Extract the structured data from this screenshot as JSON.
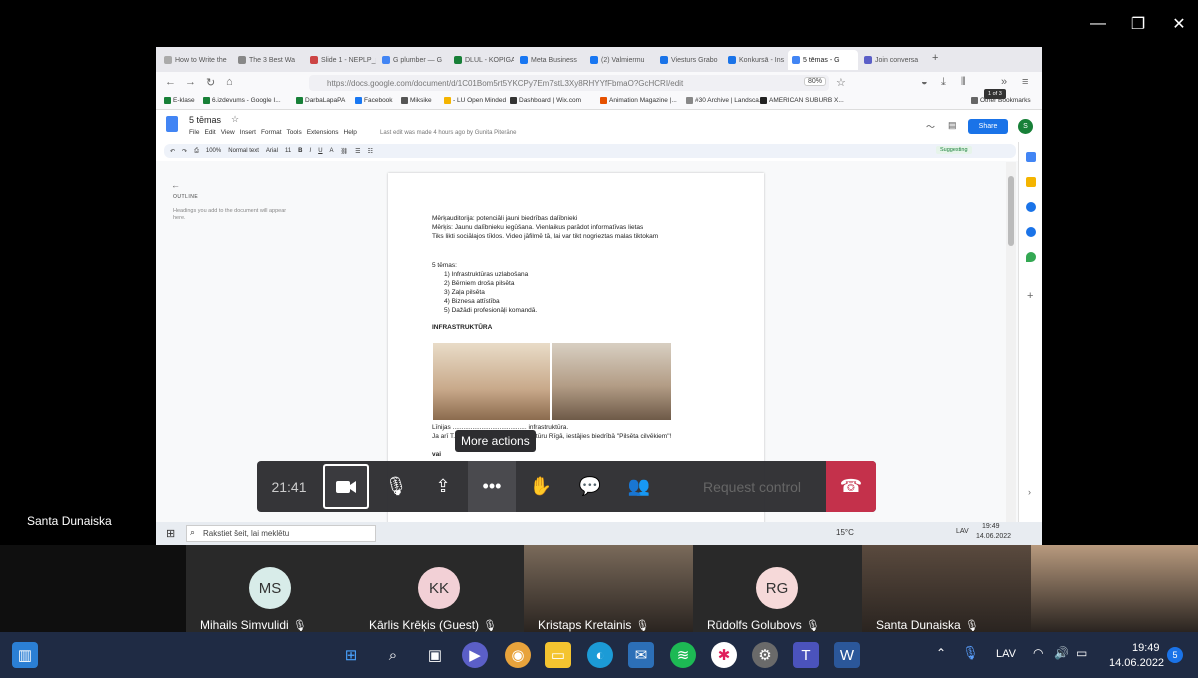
{
  "window": {
    "minimize_icon": "—",
    "maximize_icon": "❐",
    "close_icon": "✕"
  },
  "browser": {
    "tabs": [
      {
        "label": "How to Write the",
        "color": "#aaa"
      },
      {
        "label": "The 3 Best Wa",
        "color": "#888"
      },
      {
        "label": "Slide 1 - NEPLP_p",
        "color": "#c44"
      },
      {
        "label": "G plumber — G",
        "color": "#4285f4"
      },
      {
        "label": "DLUL - KOPIGA",
        "color": "#188038"
      },
      {
        "label": "Meta Business",
        "color": "#1877f2"
      },
      {
        "label": "(2) Valmiermu",
        "color": "#1877f2"
      },
      {
        "label": "Viesturs Grabo",
        "color": "#1a73e8"
      },
      {
        "label": "Konkursā - Ins",
        "color": "#1a73e8"
      },
      {
        "label": "5 tēmas - G",
        "color": "#4285f4"
      },
      {
        "label": "Join conversa",
        "color": "#5b5fc7"
      }
    ],
    "new_tab": "+",
    "url": "https://docs.google.com/document/d/1C01Bom5rt5YKCPy7Em7stL3Xy8RHYYfFbmaO?GcHCRI/edit",
    "zoom": "80%",
    "bookmarks": [
      "E-klase",
      "6.izdevums - Google I...",
      "DarbaLapaPA",
      "Facebook",
      "Miksike",
      "- LU Open Minded",
      "Dashboard | Wix.com",
      "Animation Magazine |...",
      "#30 Archive | Landsca...",
      "AMERICAN SUBURB X...",
      "Other Bookmarks"
    ],
    "bookmark_colors": [
      "#188038",
      "#188038",
      "#188038",
      "#1877f2",
      "#555",
      "#f4b400",
      "#333",
      "#e65100",
      "#888",
      "#222",
      "#666"
    ]
  },
  "docs": {
    "title": "5 tēmas",
    "menu": [
      "File",
      "Edit",
      "View",
      "Insert",
      "Format",
      "Tools",
      "Extensions",
      "Help"
    ],
    "last_edit": "Last edit was made 4 hours ago by Gunita Piterāne",
    "share": "Share",
    "avatar": "S",
    "toolbar": {
      "zoom": "100%",
      "style": "Normal text",
      "font": "Arial",
      "size": "11",
      "mode": "Suggesting"
    },
    "outline_label": "OUTLINE",
    "outline_hint": "Headings you add to the document will appear here.",
    "page_count": "1 of 3",
    "lines": [
      "Mērķauditorija: potenciāli jauni biedrības dalībnieki",
      "Mērķis: Jaunu dalībnieku iegūšana. Vienlaikus parādot informatīvas lietas",
      "Tiks likti sociālajos tīklos. Video jāfilmē tā, lai var tikt nogrieztas malas tiktokam"
    ],
    "topics_label": "5 tēmas:",
    "topics": [
      "1)  Infrastruktūras uzlabošana",
      "2)  Bērniem droša pilsēta",
      "3)  Zaļa pilsēta",
      "4)  Biznesa attīstība",
      "5)  Dažādi profesionāļi komandā."
    ],
    "section_heading": "INFRASTRUKTŪRA",
    "caption1": "Līnijas ......................................... infrastruktūra.",
    "caption2": "Ja arī T.............................. infrastruktūru Rīgā, iestājies biedrībā \"Pilsēta cilvēkiem\"!",
    "vai": "vai"
  },
  "inner_taskbar": {
    "search": "Rakstiet šeit, lai meklētu",
    "weather": "15°C",
    "lang": "LAV",
    "time": "19:49",
    "date": "14.06.2022"
  },
  "call": {
    "timer": "21:41",
    "request_control": "Request control",
    "tooltip": "More actions",
    "presenter": "Santa Dunaiska"
  },
  "participants": [
    {
      "initials": "MS",
      "name": "Mihails Simvulidi",
      "color": "#d8ece9",
      "video": false
    },
    {
      "initials": "KK",
      "name": "Kārlis Krēķis (Guest)",
      "color": "#f2d0d6",
      "video": false
    },
    {
      "initials": "",
      "name": "Kristaps Kretainis",
      "color": "#7a6a5a",
      "video": true
    },
    {
      "initials": "RG",
      "name": "Rūdolfs Golubovs",
      "color": "#f6d9d9",
      "video": false
    },
    {
      "initials": "",
      "name": "Santa Dunaiska",
      "color": "#5a4a3e",
      "video": true
    },
    {
      "initials": "",
      "name": "",
      "color": "#b89a7e",
      "video": true
    }
  ],
  "taskbar": {
    "lang": "LAV",
    "time": "19:49",
    "date": "14.06.2022",
    "notification_count": "5"
  }
}
